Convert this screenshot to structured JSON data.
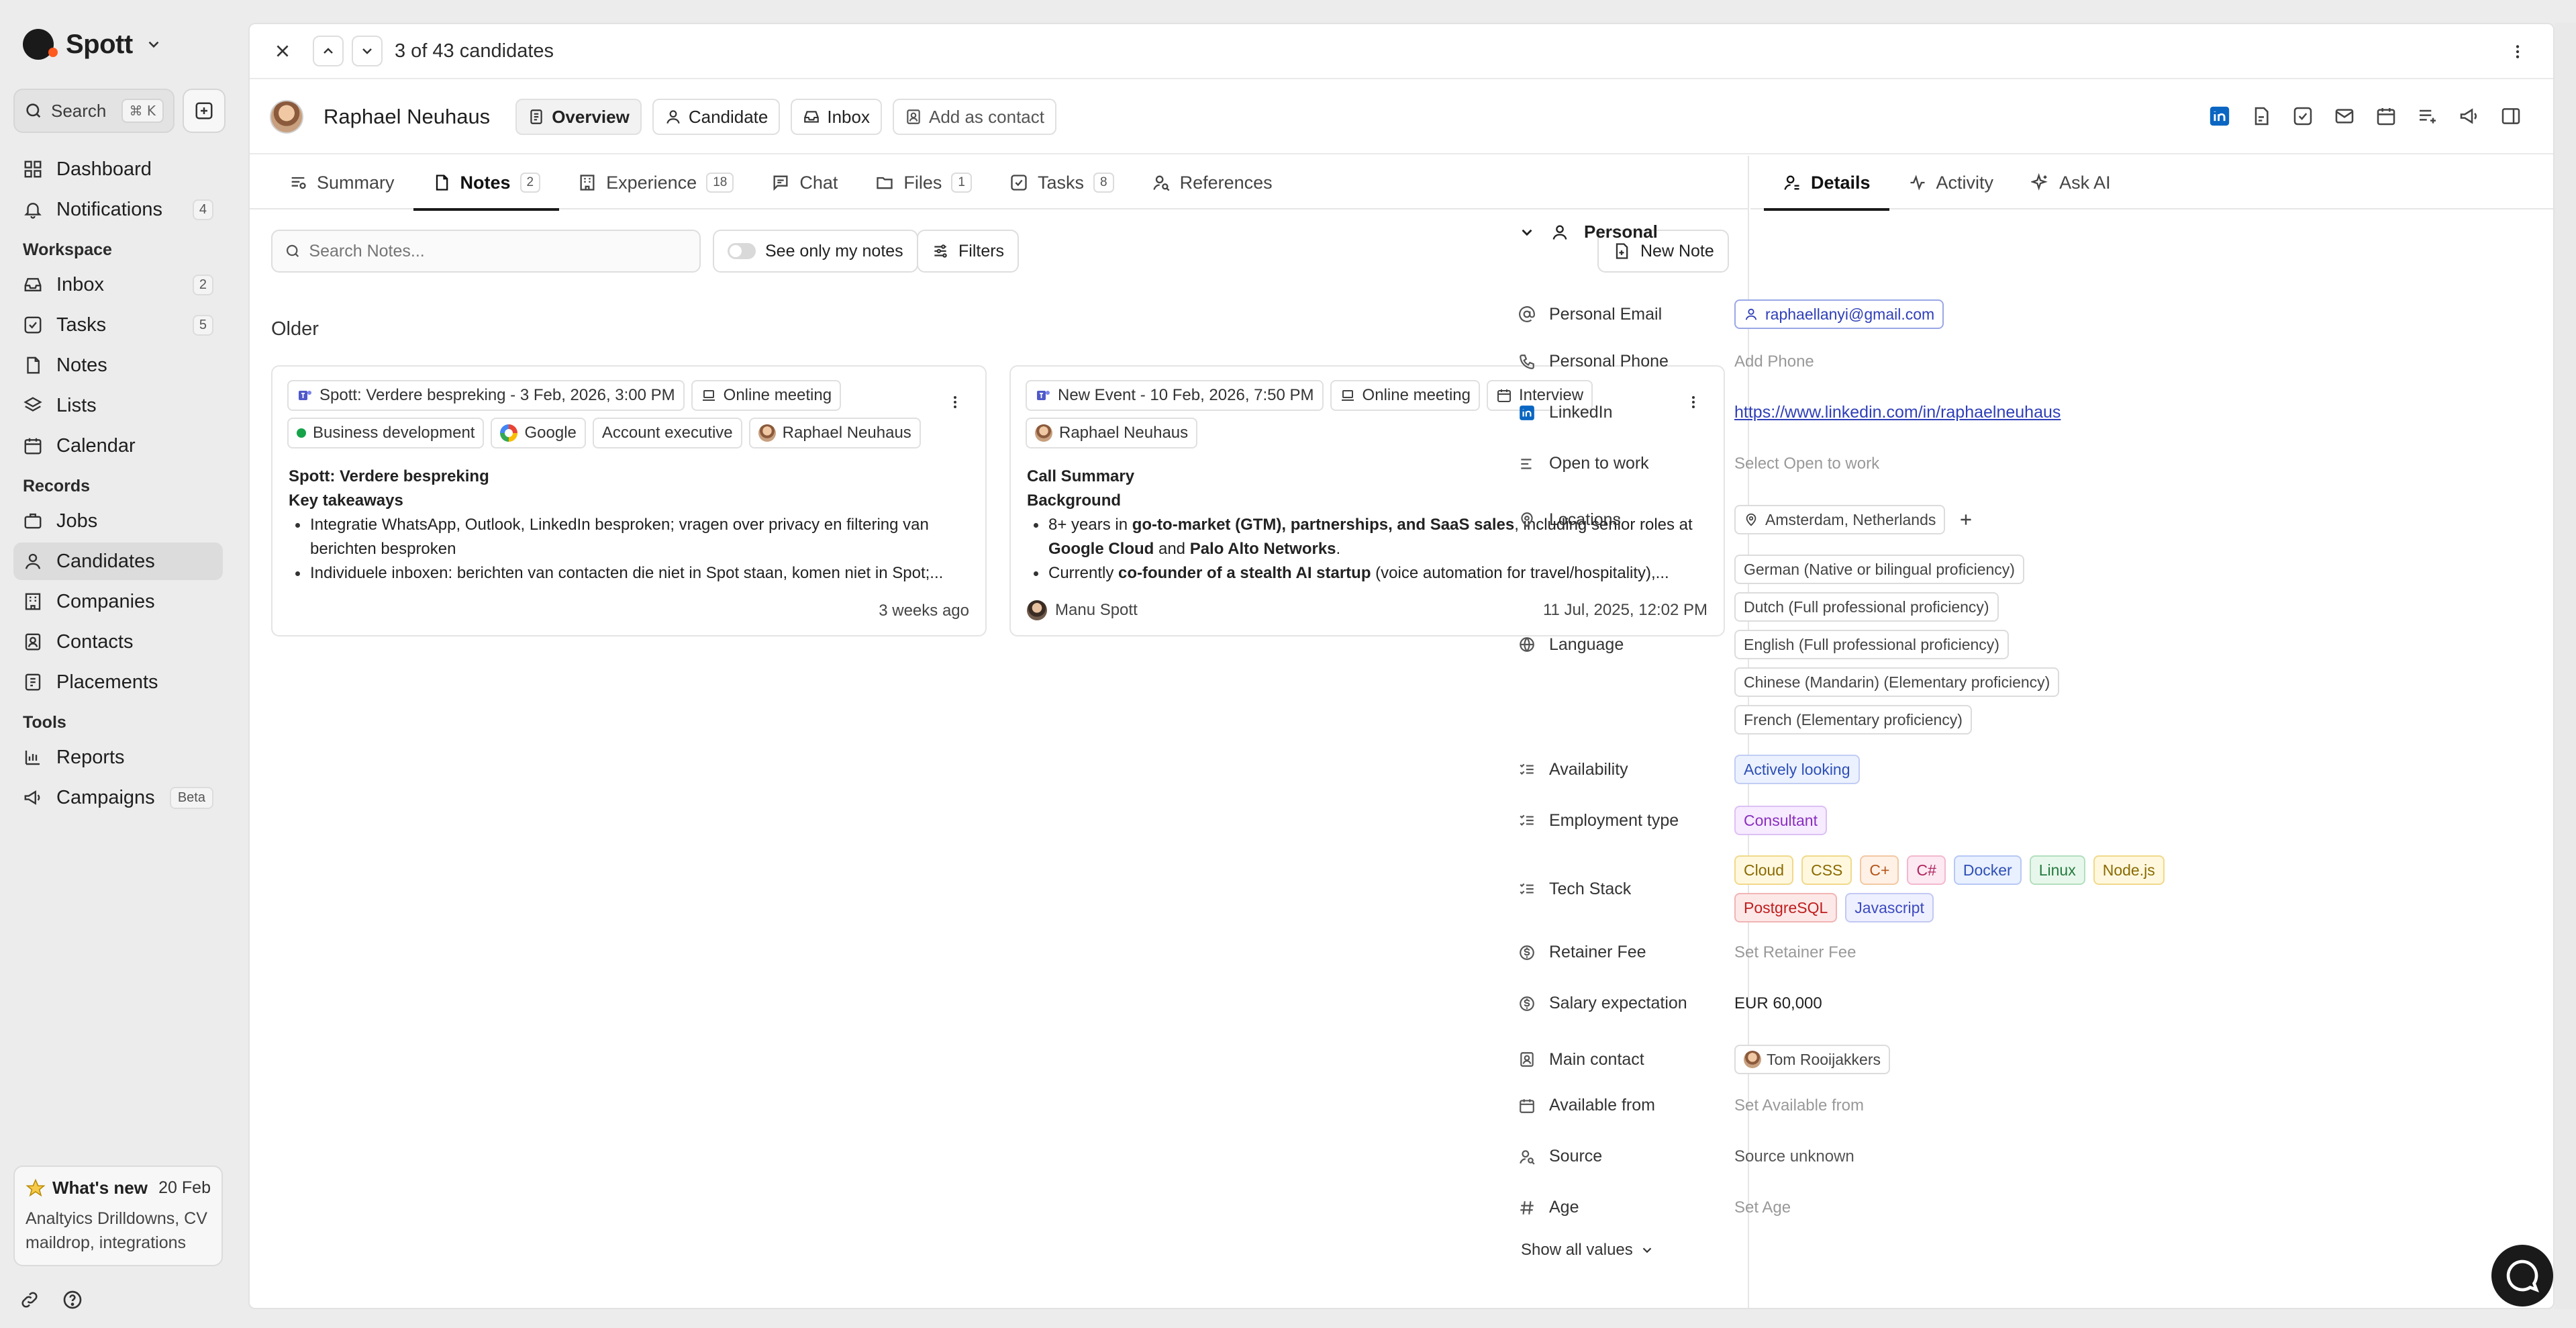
{
  "brand": {
    "name": "Spott"
  },
  "sidebar": {
    "search_label": "Search",
    "search_shortcut": "⌘ K",
    "items": [
      {
        "label": "Dashboard",
        "icon": "grid-icon"
      },
      {
        "label": "Notifications",
        "icon": "bell-icon",
        "count": "4"
      }
    ],
    "workspace_label": "Workspace",
    "workspace": [
      {
        "label": "Inbox",
        "icon": "inbox-icon",
        "count": "2"
      },
      {
        "label": "Tasks",
        "icon": "checkbox-icon",
        "count": "5"
      },
      {
        "label": "Notes",
        "icon": "note-icon"
      },
      {
        "label": "Lists",
        "icon": "layers-icon"
      },
      {
        "label": "Calendar",
        "icon": "calendar-icon"
      }
    ],
    "records_label": "Records",
    "records": [
      {
        "label": "Jobs",
        "icon": "briefcase-icon"
      },
      {
        "label": "Candidates",
        "icon": "user-icon"
      },
      {
        "label": "Companies",
        "icon": "building-icon"
      },
      {
        "label": "Contacts",
        "icon": "contact-icon"
      },
      {
        "label": "Placements",
        "icon": "placement-icon"
      }
    ],
    "tools_label": "Tools",
    "tools": [
      {
        "label": "Reports",
        "icon": "bar-chart-icon"
      },
      {
        "label": "Campaigns",
        "icon": "megaphone-icon",
        "badge": "Beta"
      }
    ],
    "whats_new": {
      "title": "What's new",
      "date": "20 Feb",
      "body": "Analtyics Drilldowns, CV maildrop, integrations"
    }
  },
  "topbar": {
    "counter": "3 of 43 candidates"
  },
  "candidate": {
    "name": "Raphael  Neuhaus",
    "buttons": {
      "overview": "Overview",
      "candidate": "Candidate",
      "inbox": "Inbox",
      "add_contact": "Add as contact"
    }
  },
  "tabs": [
    {
      "label": "Summary"
    },
    {
      "label": "Notes",
      "badge": "2"
    },
    {
      "label": "Experience",
      "badge": "18"
    },
    {
      "label": "Chat"
    },
    {
      "label": "Files",
      "badge": "1"
    },
    {
      "label": "Tasks",
      "badge": "8"
    },
    {
      "label": "References"
    }
  ],
  "right_tabs": [
    {
      "label": "Details"
    },
    {
      "label": "Activity"
    },
    {
      "label": "Ask AI"
    }
  ],
  "notes": {
    "search_placeholder": "Search Notes...",
    "toggle_label": "See only my notes",
    "filters_label": "Filters",
    "new_note_label": "New Note",
    "group_label": "Older",
    "cards": [
      {
        "event": "Spott: Verdere bespreking - 3 Feb, 2026, 3:00 PM",
        "meeting_type": "Online meeting",
        "category": "Business development",
        "company": "Google",
        "role": "Account executive",
        "person": "Raphael Neuhaus",
        "title": "Spott: Verdere bespreking",
        "subtitle": "Key takeaways",
        "bullet1": "Integratie WhatsApp, Outlook, LinkedIn besproken; vragen over privacy en filtering van berichten besproken",
        "bullet2": "Individuele inboxen: berichten van contacten die niet in Spot staan, komen niet in Spot;...",
        "time": "3 weeks ago"
      },
      {
        "event": "New Event - 10 Feb, 2026, 7:50 PM",
        "meeting_type": "Online meeting",
        "category": "Interview",
        "person": "Raphael Neuhaus",
        "title": "Call Summary",
        "subtitle": "Background",
        "b1_pre": "8+ years in ",
        "b1_bold": "go-to-market (GTM), partnerships, and SaaS sales",
        "b1_post": ", including senior roles at ",
        "b1_bold2": "Google Cloud",
        "b1_and": " and ",
        "b1_bold3": "Palo Alto Networks",
        "b1_end": ".",
        "b2_pre": "Currently ",
        "b2_bold": "co-founder of a stealth AI startup",
        "b2_post": " (voice automation for travel/hospitality),...",
        "author": "Manu Spott",
        "time": "11 Jul, 2025, 12:02 PM"
      }
    ]
  },
  "details": {
    "section": "Personal",
    "personal_email_label": "Personal Email",
    "personal_email": "raphaellanyi@gmail.com",
    "personal_phone_label": "Personal Phone",
    "personal_phone": "Add Phone",
    "linkedin_label": "LinkedIn",
    "linkedin": "https://www.linkedin.com/in/raphaelneuhaus",
    "open_to_work_label": "Open to work",
    "open_to_work": "Select Open to work",
    "locations_label": "Locations",
    "location": "Amsterdam, Netherlands",
    "language_label": "Language",
    "languages": [
      "German (Native or bilingual proficiency)",
      "Dutch (Full professional proficiency)",
      "English (Full professional proficiency)",
      "Chinese (Mandarin) (Elementary proficiency)",
      "French (Elementary proficiency)"
    ],
    "availability_label": "Availability",
    "availability": "Actively looking",
    "employment_type_label": "Employment type",
    "employment_type": "Consultant",
    "tech_stack_label": "Tech Stack",
    "tech_stack": [
      "Cloud",
      "CSS",
      "C+",
      "C#",
      "Docker",
      "Linux",
      "Node.js",
      "PostgreSQL",
      "Javascript"
    ],
    "retainer_fee_label": "Retainer Fee",
    "retainer_fee": "Set Retainer Fee",
    "salary_label": "Salary expectation",
    "salary": "EUR 60,000",
    "main_contact_label": "Main contact",
    "main_contact": "Tom Rooijakkers",
    "available_from_label": "Available from",
    "available_from": "Set Available from",
    "source_label": "Source",
    "source": "Source unknown",
    "age_label": "Age",
    "age": "Set Age",
    "show_all": "Show all values"
  }
}
